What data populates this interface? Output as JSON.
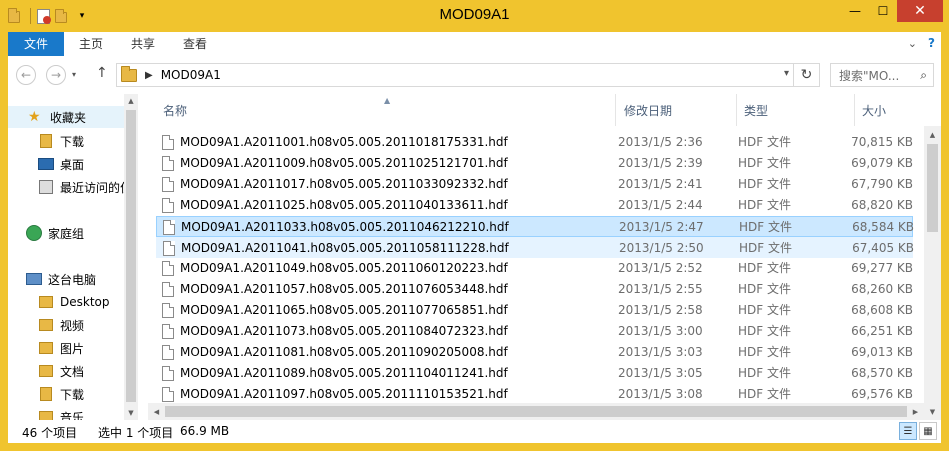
{
  "window": {
    "title": "MOD09A1",
    "minimize": "—",
    "maximize": "☐",
    "close": "✕"
  },
  "ribbon": {
    "tabs": [
      "文件",
      "主页",
      "共享",
      "查看"
    ],
    "help": "?",
    "expand": "⌄"
  },
  "address": {
    "path": "MOD09A1",
    "search_placeholder": "搜索\"MO...",
    "back": "←",
    "forward": "→",
    "up": "↑",
    "refresh": "↻"
  },
  "nav": {
    "items": [
      {
        "label": "收藏夹",
        "icon": "star-icon"
      },
      {
        "label": "下载",
        "icon": "download-folder-icon"
      },
      {
        "label": "桌面",
        "icon": "desktop-icon"
      },
      {
        "label": "最近访问的位",
        "icon": "recent-places-icon"
      },
      {
        "label": "家庭组",
        "icon": "homegroup-icon"
      },
      {
        "label": "这台电脑",
        "icon": "this-pc-icon"
      },
      {
        "label": "Desktop",
        "icon": "folder-icon"
      },
      {
        "label": "视频",
        "icon": "videos-folder-icon"
      },
      {
        "label": "图片",
        "icon": "pictures-folder-icon"
      },
      {
        "label": "文档",
        "icon": "documents-folder-icon"
      },
      {
        "label": "下载",
        "icon": "download-folder-icon"
      },
      {
        "label": "音乐",
        "icon": "music-folder-icon"
      }
    ]
  },
  "columns": {
    "name": "名称",
    "date": "修改日期",
    "type": "类型",
    "size": "大小"
  },
  "files": [
    {
      "name": "MOD09A1.A2011001.h08v05.005.2011018175331.hdf",
      "date": "2013/1/5 2:36",
      "type": "HDF 文件",
      "size": "70,815 KB"
    },
    {
      "name": "MOD09A1.A2011009.h08v05.005.2011025121701.hdf",
      "date": "2013/1/5 2:39",
      "type": "HDF 文件",
      "size": "69,079 KB"
    },
    {
      "name": "MOD09A1.A2011017.h08v05.005.2011033092332.hdf",
      "date": "2013/1/5 2:41",
      "type": "HDF 文件",
      "size": "67,790 KB"
    },
    {
      "name": "MOD09A1.A2011025.h08v05.005.2011040133611.hdf",
      "date": "2013/1/5 2:44",
      "type": "HDF 文件",
      "size": "68,820 KB"
    },
    {
      "name": "MOD09A1.A2011033.h08v05.005.2011046212210.hdf",
      "date": "2013/1/5 2:47",
      "type": "HDF 文件",
      "size": "68,584 KB"
    },
    {
      "name": "MOD09A1.A2011041.h08v05.005.2011058111228.hdf",
      "date": "2013/1/5 2:50",
      "type": "HDF 文件",
      "size": "67,405 KB"
    },
    {
      "name": "MOD09A1.A2011049.h08v05.005.2011060120223.hdf",
      "date": "2013/1/5 2:52",
      "type": "HDF 文件",
      "size": "69,277 KB"
    },
    {
      "name": "MOD09A1.A2011057.h08v05.005.2011076053448.hdf",
      "date": "2013/1/5 2:55",
      "type": "HDF 文件",
      "size": "68,260 KB"
    },
    {
      "name": "MOD09A1.A2011065.h08v05.005.2011077065851.hdf",
      "date": "2013/1/5 2:58",
      "type": "HDF 文件",
      "size": "68,608 KB"
    },
    {
      "name": "MOD09A1.A2011073.h08v05.005.2011084072323.hdf",
      "date": "2013/1/5 3:00",
      "type": "HDF 文件",
      "size": "66,251 KB"
    },
    {
      "name": "MOD09A1.A2011081.h08v05.005.2011090205008.hdf",
      "date": "2013/1/5 3:03",
      "type": "HDF 文件",
      "size": "69,013 KB"
    },
    {
      "name": "MOD09A1.A2011089.h08v05.005.2011104011241.hdf",
      "date": "2013/1/5 3:05",
      "type": "HDF 文件",
      "size": "68,570 KB"
    },
    {
      "name": "MOD09A1.A2011097.h08v05.005.2011110153521.hdf",
      "date": "2013/1/5 3:08",
      "type": "HDF 文件",
      "size": "69,576 KB"
    }
  ],
  "selected_index": 4,
  "hover_index": 5,
  "status": {
    "count": "46 个项目",
    "selected": "选中 1 个项目",
    "size": "66.9 MB"
  },
  "colors": {
    "titlebar": "#f0c42e",
    "file_tab": "#1979ca",
    "selection": "#cce8ff",
    "close": "#c7402e"
  }
}
